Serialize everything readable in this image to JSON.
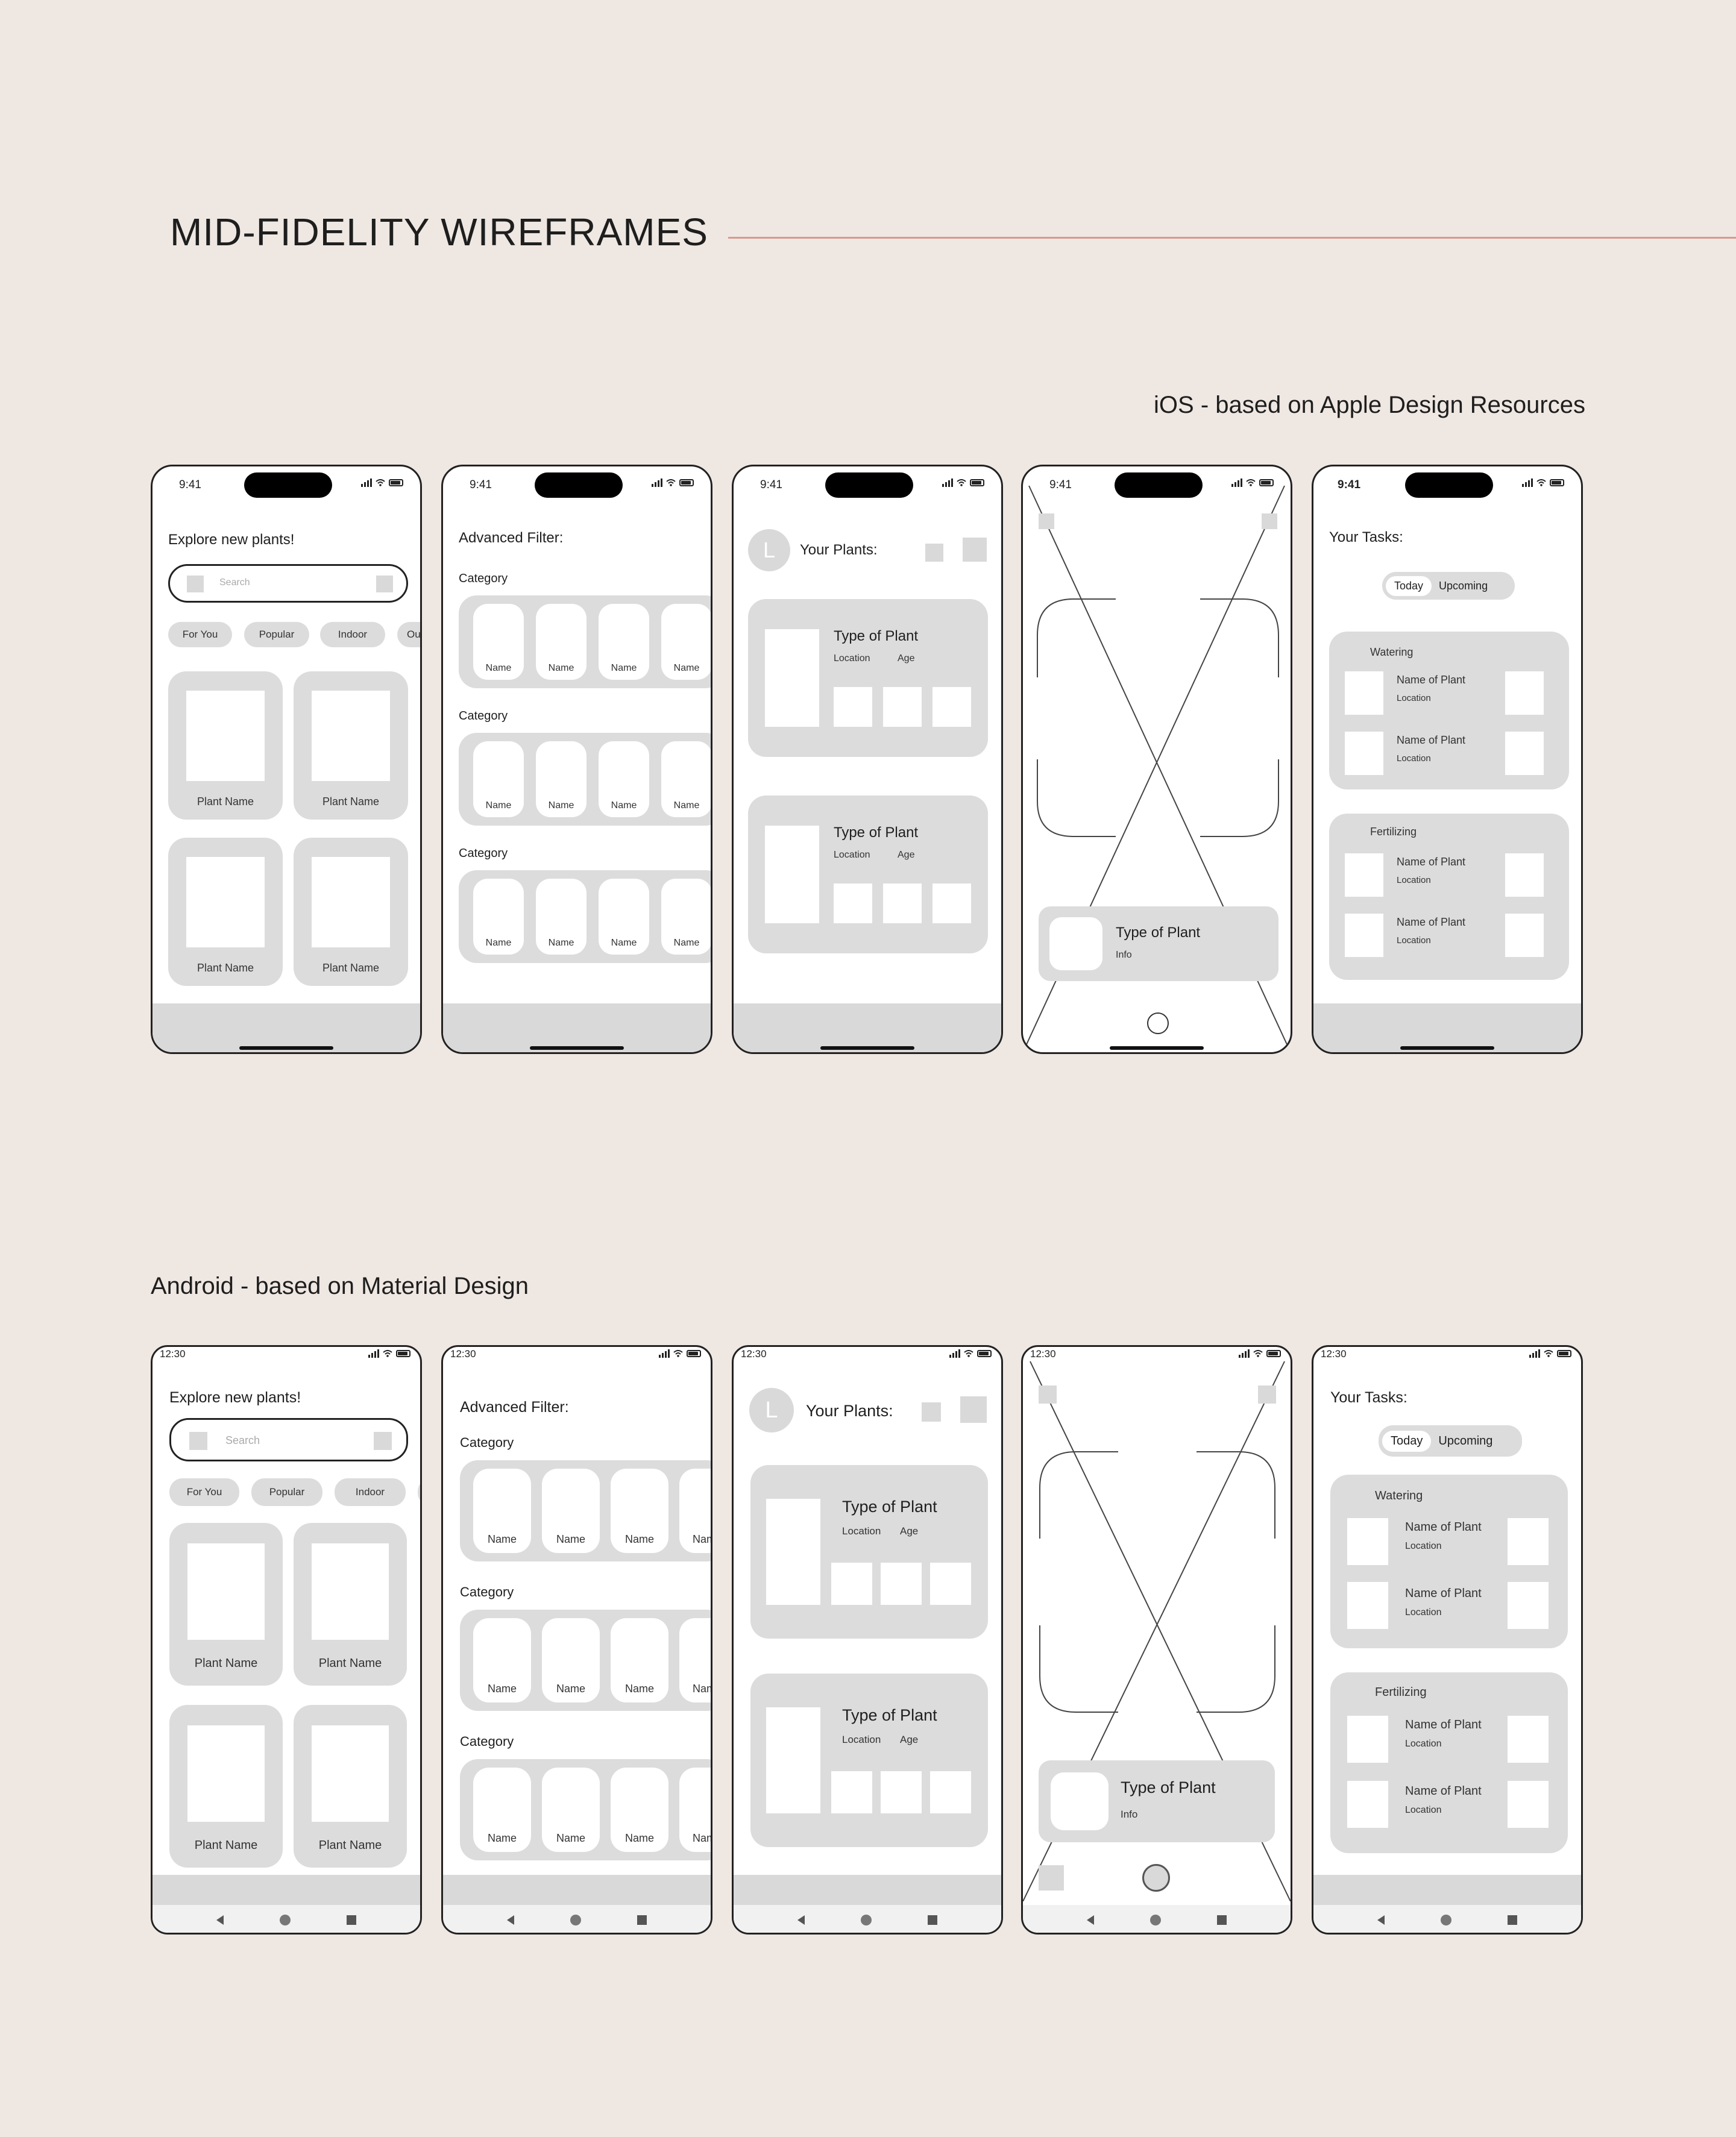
{
  "title": "MID-FIDELITY WIREFRAMES",
  "ios_caption": "iOS - based on Apple Design Resources",
  "android_caption": "Android - based on Material Design",
  "colors": {
    "background": "#EFE7E2",
    "accent_rule": "#D89A8E",
    "placeholder": "#D9D9D9"
  },
  "ios_time": "9:41",
  "android_time": "12:30",
  "explore": {
    "heading": "Explore new plants!",
    "search_placeholder": "Search",
    "chips": [
      "For You",
      "Popular",
      "Indoor",
      "Ou"
    ],
    "plant_label": "Plant Name"
  },
  "filter": {
    "heading": "Advanced Filter:",
    "category_label": "Category",
    "item_label": "Name",
    "android_cut_label": "Nam"
  },
  "my_plants": {
    "heading": "Your Plants:",
    "avatar_initial": "L",
    "card_title": "Type of Plant",
    "location": "Location",
    "age": "Age"
  },
  "scan": {
    "card_title": "Type of Plant",
    "card_info": "Info"
  },
  "tasks": {
    "heading": "Your Tasks:",
    "tab_today": "Today",
    "tab_upcoming": "Upcoming",
    "group_watering": "Watering",
    "group_fertilizing": "Fertilizing",
    "item_name": "Name of Plant",
    "item_location": "Location"
  }
}
